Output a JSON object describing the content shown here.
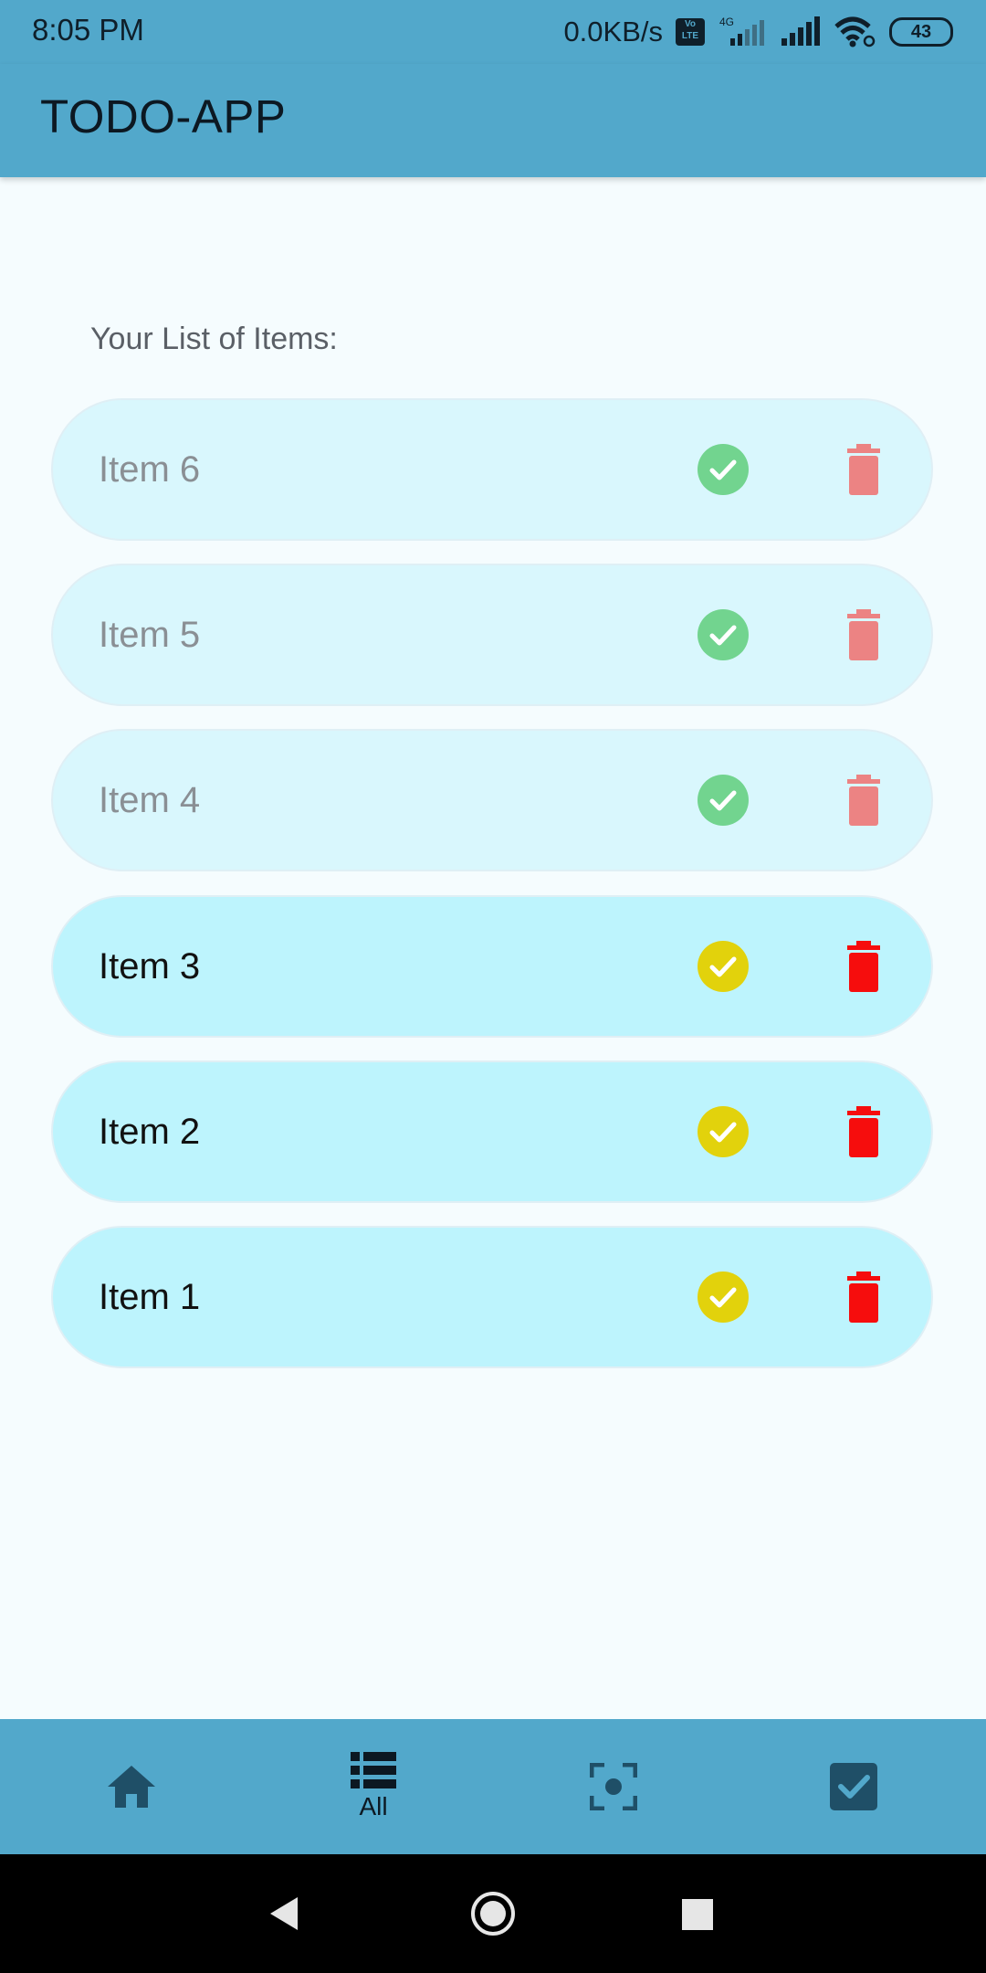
{
  "status_bar": {
    "time": "8:05 PM",
    "net_speed": "0.0KB/s",
    "volte_top": "Vo",
    "volte_bottom": "LTE",
    "network_type": "4G",
    "battery": "43"
  },
  "app_bar": {
    "title": "TODO-APP"
  },
  "list": {
    "heading": "Your List of Items:",
    "items": [
      {
        "label": "Item 6",
        "status": "done"
      },
      {
        "label": "Item 5",
        "status": "done"
      },
      {
        "label": "Item 4",
        "status": "done"
      },
      {
        "label": "Item 3",
        "status": "pending"
      },
      {
        "label": "Item 2",
        "status": "pending"
      },
      {
        "label": "Item 1",
        "status": "pending"
      }
    ]
  },
  "bottom_nav": {
    "items": [
      {
        "icon": "home-icon",
        "label": ""
      },
      {
        "icon": "list-icon",
        "label": "All",
        "active": true
      },
      {
        "icon": "focus-icon",
        "label": ""
      },
      {
        "icon": "checkbox-icon",
        "label": ""
      }
    ]
  },
  "colors": {
    "primary": "#52a8cb",
    "done_check": "#72d48f",
    "done_trash": "#ec8383",
    "pending_check": "#e2d20c",
    "pending_trash": "#f60d0d",
    "done_row": "#d9f7fd",
    "pending_row": "#bdf4fd"
  }
}
